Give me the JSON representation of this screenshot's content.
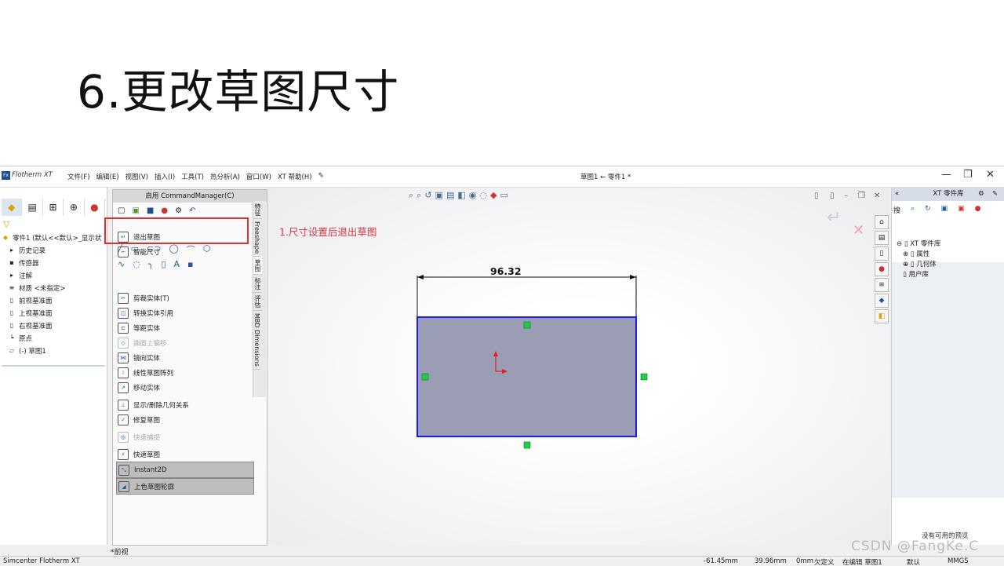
{
  "slide": {
    "title": "6.更改草图尺寸"
  },
  "app": {
    "name": "Flotherm XT",
    "doc_title": "草图1 ← 零件1 *",
    "menu": [
      "文件(F)",
      "编辑(E)",
      "视图(V)",
      "插入(I)",
      "工具(T)",
      "热分析(A)",
      "窗口(W)",
      "XT 帮助(H)"
    ]
  },
  "tree": {
    "rows": [
      {
        "icon": "part-icon",
        "label": "零件1 (默认<<默认>_显示状"
      },
      {
        "icon": "folder-icon",
        "label": "历史记录"
      },
      {
        "icon": "sensor-icon",
        "label": "传感器"
      },
      {
        "icon": "annotation-icon",
        "label": "注解"
      },
      {
        "icon": "material-icon",
        "label": "材质 <未指定>"
      },
      {
        "icon": "plane-icon",
        "label": "前视基准面"
      },
      {
        "icon": "plane-icon",
        "label": "上视基准面"
      },
      {
        "icon": "plane-icon",
        "label": "右视基准面"
      },
      {
        "icon": "origin-icon",
        "label": "原点"
      },
      {
        "icon": "sketch-icon",
        "label": "(-) 草图1"
      }
    ]
  },
  "command_manager": {
    "header": "启用 CommandManager(C)",
    "items": [
      {
        "label": "退出草图",
        "state": "normal"
      },
      {
        "label": "智能尺寸",
        "state": "normal"
      },
      {
        "label": "剪裁实体(T)",
        "state": "normal"
      },
      {
        "label": "转换实体引用",
        "state": "normal"
      },
      {
        "label": "等距实体",
        "state": "normal"
      },
      {
        "label": "曲面上偏移",
        "state": "dim"
      },
      {
        "label": "镜向实体",
        "state": "normal"
      },
      {
        "label": "线性草图阵列",
        "state": "normal"
      },
      {
        "label": "移动实体",
        "state": "normal"
      },
      {
        "label": "显示/删除几何关系",
        "state": "normal"
      },
      {
        "label": "修复草图",
        "state": "normal"
      },
      {
        "label": "快速捕捉",
        "state": "dim"
      },
      {
        "label": "快速草图",
        "state": "normal"
      },
      {
        "label": "Instant2D",
        "state": "boxed"
      },
      {
        "label": "上色草图轮廓",
        "state": "boxed"
      }
    ],
    "vertical_tabs": [
      "特征",
      "Freeshape",
      "草图",
      "标注",
      "评估",
      "MBD Dimensions"
    ]
  },
  "annotation": "1.尺寸设置后退出草图",
  "sketch": {
    "dimension": "96.32"
  },
  "view_label": "*前视",
  "xt_library": {
    "header": "XT 零件库",
    "tree": [
      "XT 零件库",
      "属性",
      "几何体",
      "用户库"
    ],
    "no_preview": "没有可用的预览",
    "search_tab": "搜"
  },
  "status_bar": {
    "app": "Simcenter Flotherm XT",
    "x": "-61.45mm",
    "y": "39.96mm",
    "z": "0mm",
    "state": "欠定义",
    "mode": "在编辑 草图1",
    "config": "默认",
    "units": "MMGS"
  },
  "watermark": "CSDN @FangKe.C",
  "colors": {
    "accent_red": "#d9363e",
    "sketch_blue": "#1a1aff",
    "relation_green": "#22cc44"
  }
}
